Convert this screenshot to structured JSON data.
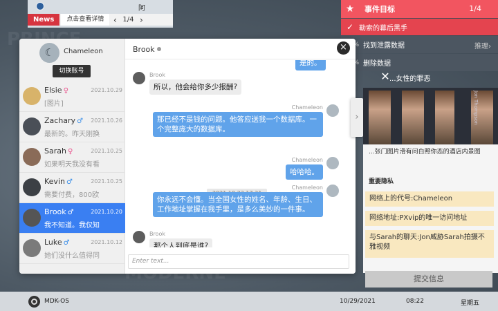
{
  "news": {
    "heading": "阿",
    "tag": "News",
    "link": "点击查看详情",
    "prev": "‹",
    "next": "›",
    "page": "1/4"
  },
  "objectives": {
    "title": "事件目标",
    "count": "1/4",
    "items": [
      {
        "prefix": "✓",
        "label": "勒索的幕后黑手",
        "hint": ""
      },
      {
        "prefix": "%",
        "label": "找到泄露数据",
        "hint": "推理›"
      },
      {
        "prefix": "0%",
        "label": "删除数据",
        "hint": ""
      },
      {
        "prefix": "",
        "label": "...",
        "hint": ""
      }
    ]
  },
  "chat_window": {
    "me": {
      "name": "Chameleon",
      "switch_label": "切换账号"
    },
    "contacts": [
      {
        "name": "Elsie",
        "gender": "♀",
        "gender_color": "#e8508a",
        "date": "2021.10.29",
        "preview": "[图片]",
        "avatar_color": "#d8b36a"
      },
      {
        "name": "Zachary",
        "gender": "♂",
        "gender_color": "#3a8ee8",
        "date": "2021.10.26",
        "preview": "最新的。昨天刚换",
        "avatar_color": "#4a4f57"
      },
      {
        "name": "Sarah",
        "gender": "♀",
        "gender_color": "#e8508a",
        "date": "2021.10.25",
        "preview": "如果明天我没有看",
        "avatar_color": "#8a6b58"
      },
      {
        "name": "Kevin",
        "gender": "♂",
        "gender_color": "#3a8ee8",
        "date": "2021.10.25",
        "preview": "需要付费，800欧",
        "avatar_color": "#3c4045"
      },
      {
        "name": "Brook",
        "gender": "♂",
        "gender_color": "#ffffff",
        "date": "2021.10.20",
        "preview": "我不知道。我仅知",
        "avatar_color": "#555555"
      },
      {
        "name": "Luke",
        "gender": "♂",
        "gender_color": "#3a8ee8",
        "date": "2021.10.12",
        "preview": "她们没什么值得同",
        "avatar_color": "#7a7a7a"
      }
    ],
    "chat_title": "Brook",
    "messages": [
      {
        "sender": "",
        "text": "是的。"
      },
      {
        "sender": "Brook",
        "text": "所以，他会给你多少报酬?"
      },
      {
        "sender": "Chameleon",
        "text": "那已经不是钱的问题。他答应送我一个数据库。一个完整庞大的数据库。"
      },
      {
        "sender": "Chameleon",
        "text": "哈哈哈。"
      },
      {
        "sender": "Chameleon",
        "text": "你永远不会懂。当全国女性的姓名、年龄、生日、工作地址掌握在我手里，是多么美妙的一件事。"
      },
      {
        "sender": "Brook",
        "text": "那个人到底是谁?"
      }
    ],
    "timestamp": "2021.10.23  17:21",
    "input_placeholder": "Enter text...",
    "close_icon": "×",
    "scroll_icon": "⇞"
  },
  "evidence": {
    "subtitle": "...女性的罪恶",
    "image_label": "Jon Thompson",
    "top_text": "...张门图片滑有问白照你态的酒店内景图",
    "section_title": "重要隐私",
    "items": [
      "网络上的代号:Chameleon",
      "网络地址:PXvip的唯一访问地址",
      "与Sarah的聊天:Jon威胁Sarah拍摄不雅视频"
    ],
    "submit_label": "提交信息"
  },
  "taskbar": {
    "os_name": "MDK-OS",
    "date": "10/29/2021",
    "time": "08:22",
    "weekday": "星期五"
  },
  "colors": {
    "accent_red": "#f25560",
    "selected_blue": "#3a7ff2",
    "bubble_blue": "#60a3ea"
  }
}
